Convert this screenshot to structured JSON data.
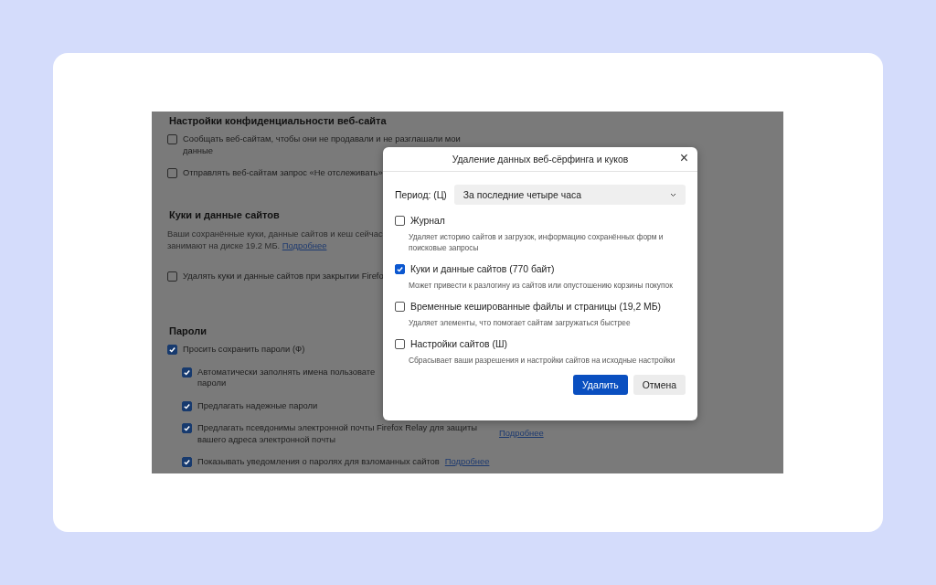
{
  "background_page": {
    "sections": [
      {
        "heading": "Настройки конфиденциальности веб-сайта",
        "items": [
          {
            "lines": [
              "Сообщать веб-сайтам, чтобы они не продавали и не разглашали мои",
              "данные"
            ],
            "checked": false
          },
          {
            "lines": [
              "Отправлять веб-сайтам запрос «Не отслеживать»"
            ],
            "checked": false
          }
        ]
      },
      {
        "heading": "Куки и данные сайтов",
        "description": [
          "Ваши сохранённые куки, данные сайтов и кеш сейчас",
          "занимают на диске 19.2 МБ."
        ],
        "description_link": "Подробнее",
        "items": [
          {
            "lines": [
              "Удалять куки и данные сайтов при закрытии Firefo"
            ],
            "checked": false
          }
        ]
      },
      {
        "heading": "Пароли",
        "items": [
          {
            "lines": [
              "Просить сохранить пароли (Ф)"
            ],
            "checked": true,
            "children": [
              {
                "lines": [
                  "Автоматически заполнять имена пользовате",
                  "пароли"
                ],
                "checked": true
              },
              {
                "lines": [
                  "Предлагать надежные пароли"
                ],
                "checked": true
              },
              {
                "lines": [
                  "Предлагать псевдонимы электронной почты Firefox Relay для защиты",
                  "вашего адреса электронной почты"
                ],
                "checked": true,
                "side_link": "Подробнее"
              },
              {
                "lines": [
                  "Показывать уведомления о паролях для взломанных сайтов"
                ],
                "checked": true,
                "inline_link": "Подробнее"
              }
            ]
          }
        ]
      }
    ]
  },
  "dialog": {
    "title": "Удаление данных веб-сёрфинга и куков",
    "close": "×",
    "period_label": "Период: (Ц)",
    "period_value": "За последние четыре часа",
    "items": [
      {
        "label": "Журнал",
        "description": "Удаляет историю сайтов и загрузок, информацию сохранённых форм и поисковые запросы",
        "checked": false
      },
      {
        "label": "Куки и данные сайтов (770 байт)",
        "description": "Может привести к разлогину из сайтов или опустошению корзины покупок",
        "checked": true
      },
      {
        "label": "Временные кешированные файлы и страницы (19,2 МБ)",
        "description": "Удаляет элементы, что помогает сайтам загружаться быстрее",
        "checked": false
      },
      {
        "label": "Настройки сайтов (Ш)",
        "description": "Сбрасывает ваши разрешения и настройки сайтов на исходные настройки",
        "checked": false
      }
    ],
    "buttons": [
      {
        "label": "Удалить",
        "kind": "primary"
      },
      {
        "label": "Отмена",
        "kind": "secondary"
      }
    ]
  }
}
